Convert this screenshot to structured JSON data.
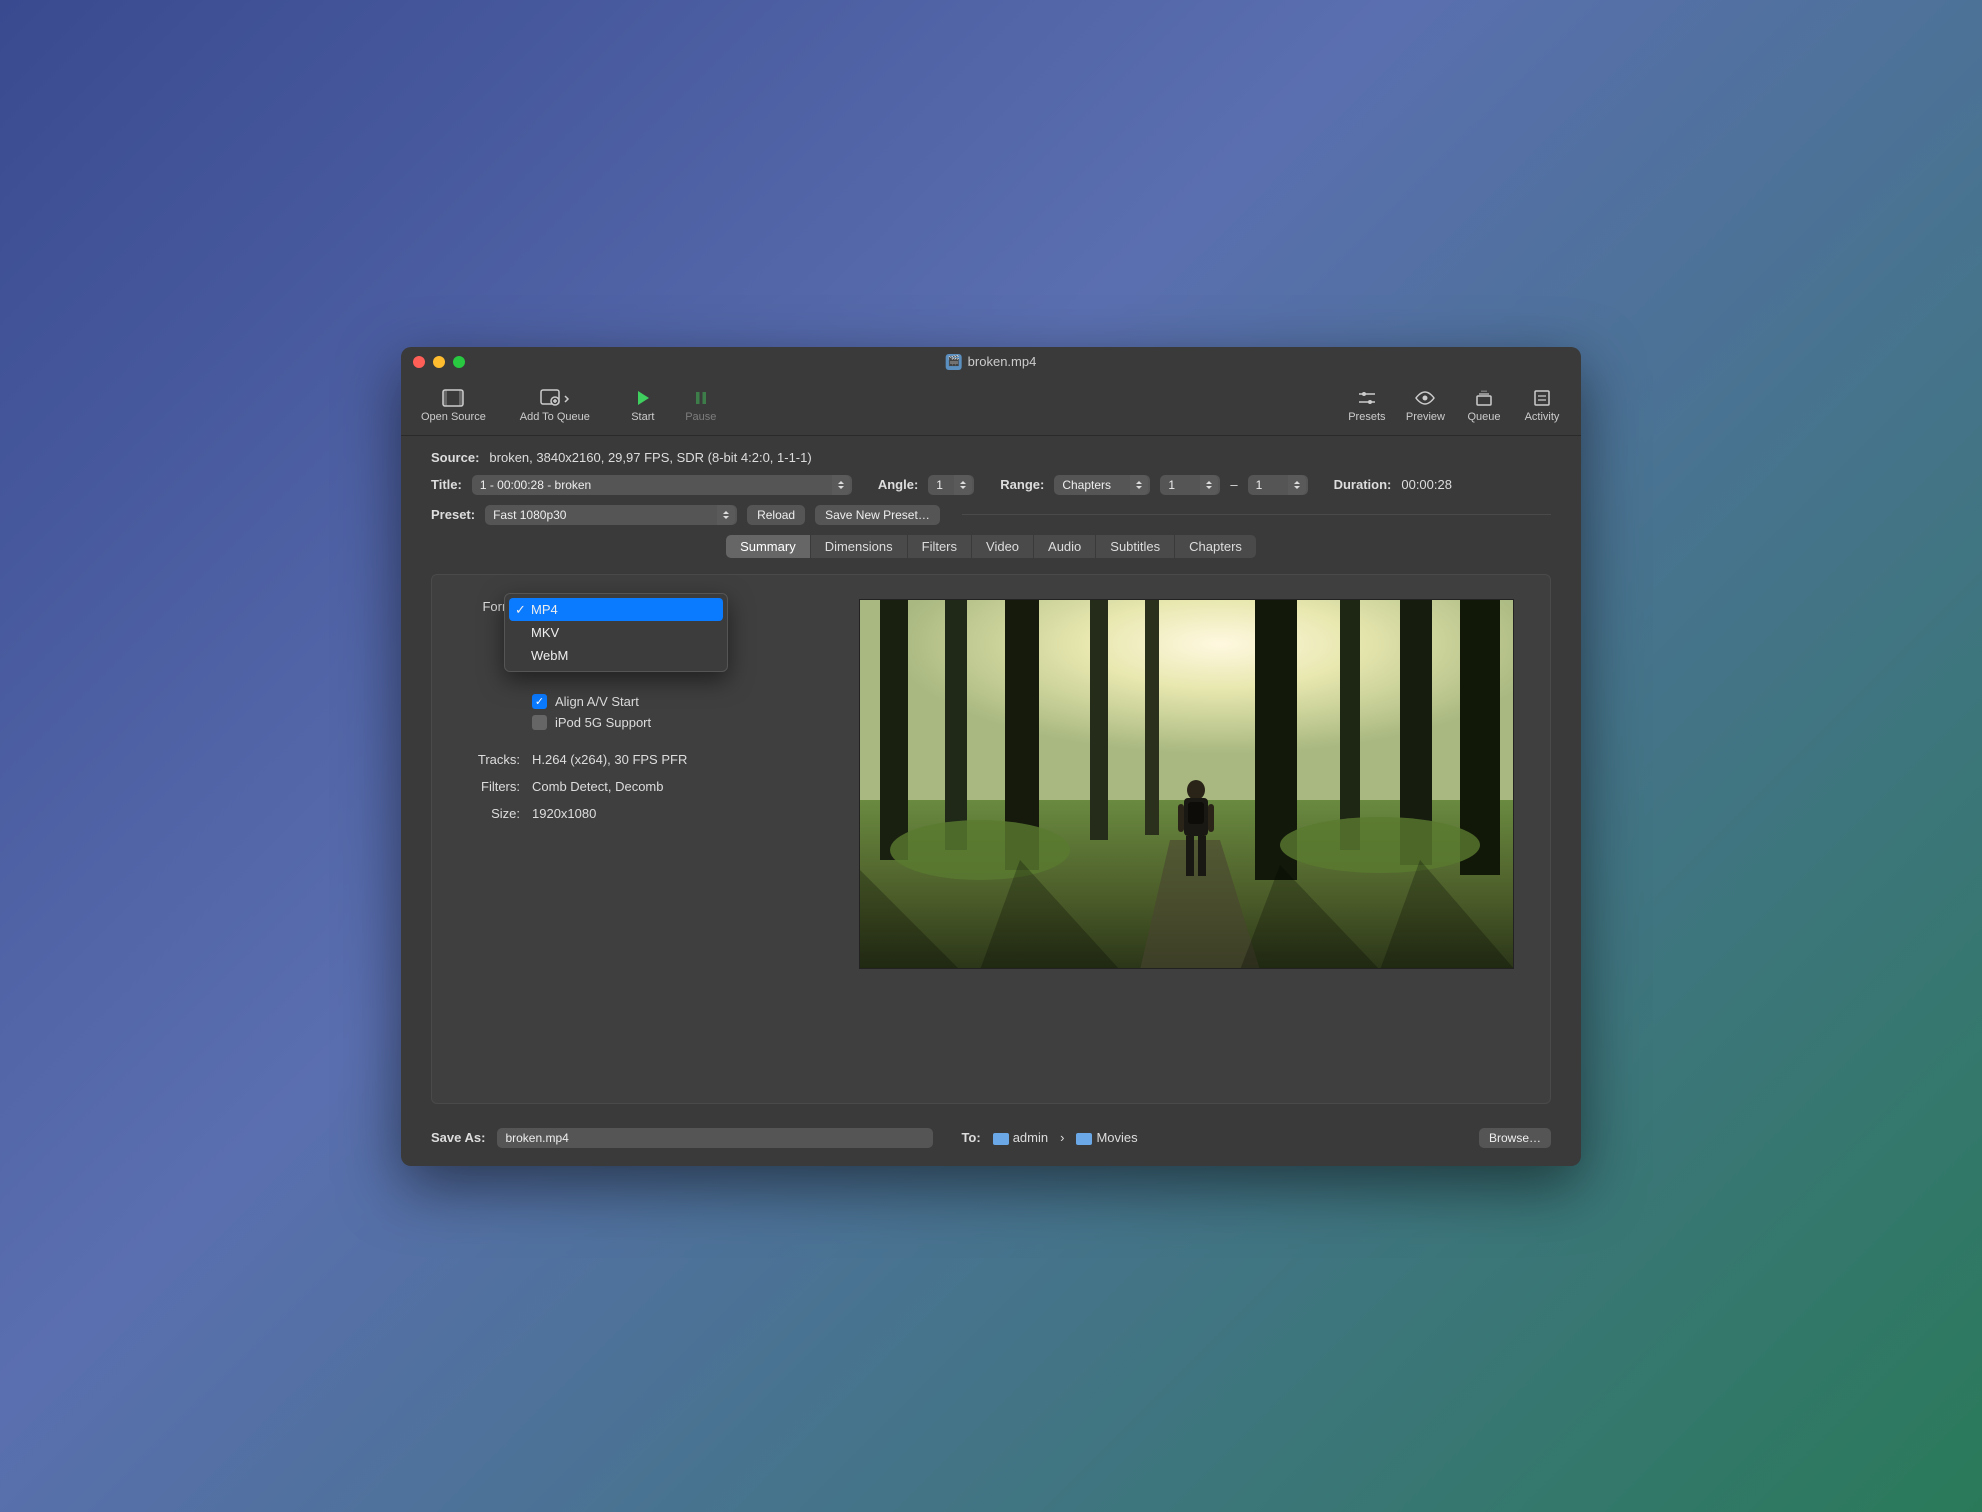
{
  "window": {
    "title": "broken.mp4"
  },
  "toolbar": {
    "open_source": "Open Source",
    "add_to_queue": "Add To Queue",
    "start": "Start",
    "pause": "Pause",
    "presets": "Presets",
    "preview": "Preview",
    "queue": "Queue",
    "activity": "Activity"
  },
  "source": {
    "label": "Source:",
    "value": "broken, 3840x2160, 29,97 FPS, SDR (8-bit 4:2:0, 1-1-1)"
  },
  "title_row": {
    "label": "Title:",
    "value": "1 - 00:00:28 - broken",
    "angle_label": "Angle:",
    "angle_value": "1",
    "range_label": "Range:",
    "range_value": "Chapters",
    "from": "1",
    "dash": "–",
    "to": "1",
    "duration_label": "Duration:",
    "duration_value": "00:00:28"
  },
  "preset_row": {
    "label": "Preset:",
    "value": "Fast 1080p30",
    "reload": "Reload",
    "save_new": "Save New Preset…"
  },
  "tabs": [
    "Summary",
    "Dimensions",
    "Filters",
    "Video",
    "Audio",
    "Subtitles",
    "Chapters"
  ],
  "summary": {
    "format_label": "Forma",
    "format_dropdown": {
      "options": [
        "MP4",
        "MKV",
        "WebM"
      ],
      "selected": "MP4"
    },
    "align_av": "Align A/V Start",
    "ipod": "iPod 5G Support",
    "tracks_label": "Tracks:",
    "tracks_value": "H.264 (x264), 30 FPS PFR",
    "filters_label": "Filters:",
    "filters_value": "Comb Detect, Decomb",
    "size_label": "Size:",
    "size_value": "1920x1080"
  },
  "save": {
    "label": "Save As:",
    "filename": "broken.mp4",
    "to_label": "To:",
    "path1": "admin",
    "sep": "›",
    "path2": "Movies",
    "browse": "Browse…"
  }
}
